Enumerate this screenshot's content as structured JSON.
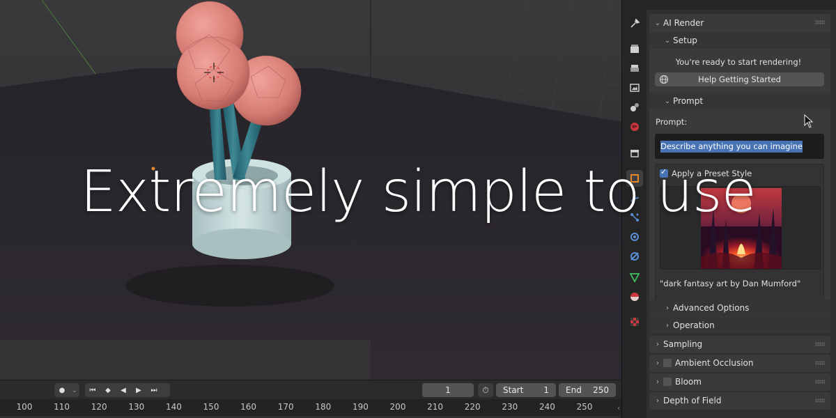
{
  "overlay": {
    "headline": "Extremely simple to use"
  },
  "timeline": {
    "current_frame": "1",
    "start_label": "Start",
    "start_value": "1",
    "end_label": "End",
    "end_value": "250",
    "ruler_ticks": [
      "100",
      "110",
      "120",
      "130",
      "140",
      "150",
      "160",
      "170",
      "180",
      "190",
      "200",
      "210",
      "220",
      "230",
      "240",
      "250"
    ]
  },
  "panel": {
    "ai_render": {
      "title": "AI Render",
      "setup_title": "Setup",
      "ready_message": "You're ready to start rendering!",
      "help_button": "Help Getting Started",
      "prompt_title": "Prompt",
      "prompt_label": "Prompt:",
      "prompt_value": "Describe anything you can imagine",
      "preset_checkbox_label": "Apply a Preset Style",
      "preset_checked": true,
      "preset_caption": "\"dark fantasy art by Dan Mumford\"",
      "advanced_options": "Advanced Options",
      "operation": "Operation"
    },
    "sections": {
      "sampling": "Sampling",
      "ambient_occlusion": "Ambient Occlusion",
      "bloom": "Bloom",
      "depth_of_field": "Depth of Field"
    }
  },
  "colors": {
    "accent_blue": "#4772b3",
    "flower_pink": "#e0837c",
    "stem_teal": "#2f6f7a",
    "pot": "#c3d8d8"
  },
  "icons": [
    "tool-icon",
    "render-icon",
    "output-icon",
    "view-layer-icon",
    "scene-icon",
    "world-icon",
    "collection-icon",
    "object-icon",
    "modifier-icon",
    "particles-icon",
    "physics-icon",
    "constraints-icon",
    "data-icon",
    "material-icon",
    "texture-icon"
  ]
}
